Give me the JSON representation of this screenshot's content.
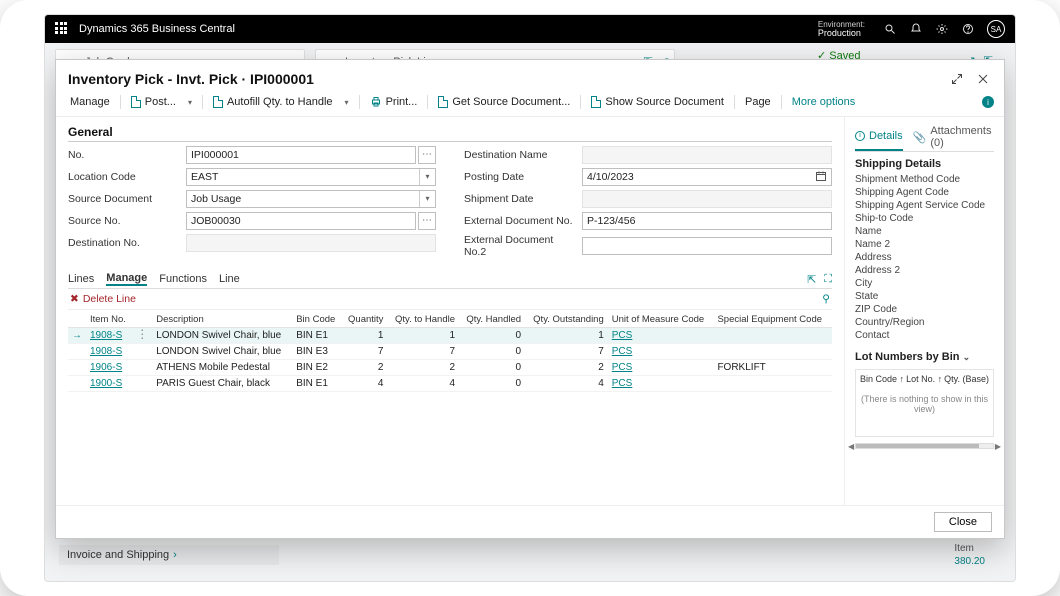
{
  "app": {
    "name": "Dynamics 365 Business Central",
    "env_label": "Environment:",
    "env_value": "Production",
    "avatar": "SA"
  },
  "background": {
    "job_card": "Job Card",
    "inv_pick_lines": "Inventory Pick Lines",
    "saved": "Saved",
    "invoice_shipping": "Invoice and Shipping",
    "item_label": "Item",
    "item_value": "380.20"
  },
  "page": {
    "title": "Inventory Pick - Invt. Pick · IPI000001",
    "toolbar": {
      "manage": "Manage",
      "post": "Post...",
      "autofill": "Autofill Qty. to Handle",
      "print": "Print...",
      "get_source": "Get Source Document...",
      "show_source": "Show Source Document",
      "page": "Page",
      "more": "More options"
    },
    "section_general": "General",
    "fields_left": {
      "no": {
        "label": "No.",
        "value": "IPI000001"
      },
      "location_code": {
        "label": "Location Code",
        "value": "EAST"
      },
      "source_document": {
        "label": "Source Document",
        "value": "Job Usage"
      },
      "source_no": {
        "label": "Source No.",
        "value": "JOB00030"
      },
      "destination_no": {
        "label": "Destination No.",
        "value": ""
      }
    },
    "fields_right": {
      "destination_name": {
        "label": "Destination Name",
        "value": ""
      },
      "posting_date": {
        "label": "Posting Date",
        "value": "4/10/2023"
      },
      "shipment_date": {
        "label": "Shipment Date",
        "value": ""
      },
      "external_doc_no": {
        "label": "External Document No.",
        "value": "P-123/456"
      },
      "external_doc_no2": {
        "label": "External Document No.2",
        "value": ""
      }
    },
    "lines": {
      "tabs": {
        "lines": "Lines",
        "manage": "Manage",
        "functions": "Functions",
        "line": "Line"
      },
      "delete_line": "Delete Line",
      "columns": {
        "item_no": "Item No.",
        "description": "Description",
        "bin_code": "Bin Code",
        "quantity": "Quantity",
        "qty_to_handle": "Qty. to Handle",
        "qty_handled": "Qty. Handled",
        "qty_outstanding": "Qty. Outstanding",
        "uom": "Unit of Measure Code",
        "special_equipment": "Special Equipment Code"
      },
      "rows": [
        {
          "item_no": "1908-S",
          "description": "LONDON Swivel Chair, blue",
          "bin": "BIN E1",
          "qty": "1",
          "to_handle": "1",
          "handled": "0",
          "outstanding": "1",
          "uom": "PCS",
          "equip": ""
        },
        {
          "item_no": "1908-S",
          "description": "LONDON Swivel Chair, blue",
          "bin": "BIN E3",
          "qty": "7",
          "to_handle": "7",
          "handled": "0",
          "outstanding": "7",
          "uom": "PCS",
          "equip": ""
        },
        {
          "item_no": "1906-S",
          "description": "ATHENS Mobile Pedestal",
          "bin": "BIN E2",
          "qty": "2",
          "to_handle": "2",
          "handled": "0",
          "outstanding": "2",
          "uom": "PCS",
          "equip": "FORKLIFT"
        },
        {
          "item_no": "1900-S",
          "description": "PARIS Guest Chair, black",
          "bin": "BIN E1",
          "qty": "4",
          "to_handle": "4",
          "handled": "0",
          "outstanding": "4",
          "uom": "PCS",
          "equip": ""
        }
      ]
    },
    "side": {
      "details": "Details",
      "attachments": "Attachments (0)",
      "shipping_title": "Shipping Details",
      "items": [
        "Shipment Method Code",
        "Shipping Agent Code",
        "Shipping Agent Service Code",
        "Ship-to Code",
        "Name",
        "Name 2",
        "Address",
        "Address 2",
        "City",
        "State",
        "ZIP Code",
        "Country/Region",
        "Contact"
      ],
      "lot_title": "Lot Numbers by Bin",
      "lot_cols": {
        "bin": "Bin Code ↑",
        "lot": "Lot No. ↑",
        "qty": "Qty. (Base)"
      },
      "lot_empty": "(There is nothing to show in this view)"
    },
    "close": "Close"
  }
}
